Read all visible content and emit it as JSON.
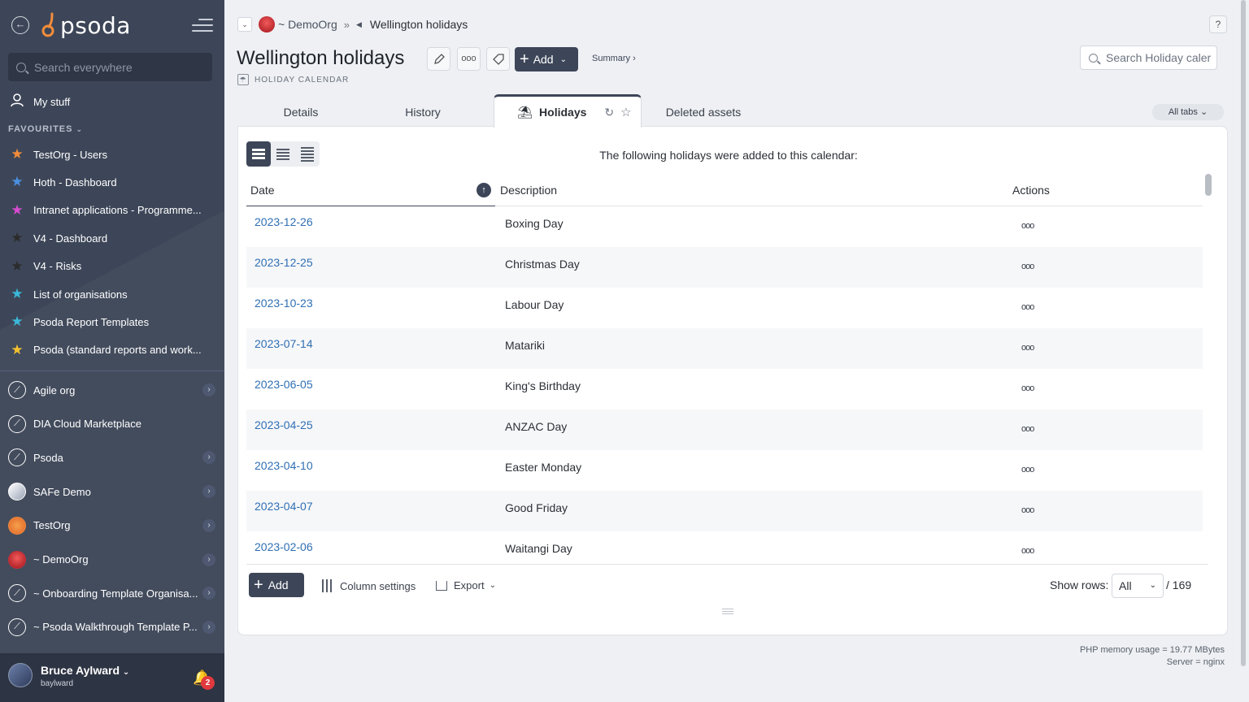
{
  "app": {
    "logo_text": "psoda"
  },
  "sidebar": {
    "search_placeholder": "Search everywhere",
    "my_stuff": "My stuff",
    "favourites_heading": "FAVOURITES",
    "favourites": [
      {
        "label": "TestOrg - Users",
        "color": "#f28c3a"
      },
      {
        "label": "Hoth - Dashboard",
        "color": "#4a90e2"
      },
      {
        "label": "Intranet applications - Programme...",
        "color": "#d84bd0"
      },
      {
        "label": "V4 - Dashboard",
        "color": "#2b2b2b"
      },
      {
        "label": "V4 - Risks",
        "color": "#2b2b2b"
      },
      {
        "label": "List of organisations",
        "color": "#3bb8d8"
      },
      {
        "label": "Psoda Report Templates",
        "color": "#3bb8d8"
      },
      {
        "label": "Psoda (standard reports and work...",
        "color": "#f2c12e"
      }
    ],
    "orgs": [
      {
        "label": "Agile org",
        "expandable": true
      },
      {
        "label": "DIA Cloud Marketplace",
        "expandable": false
      },
      {
        "label": "Psoda",
        "expandable": true
      },
      {
        "label": "SAFe Demo",
        "expandable": true
      },
      {
        "label": "TestOrg",
        "expandable": true
      },
      {
        "label": "~ DemoOrg",
        "expandable": true
      },
      {
        "label": "~ Onboarding Template Organisa...",
        "expandable": true
      },
      {
        "label": "~ Psoda Walkthrough Template P...",
        "expandable": true
      }
    ],
    "user": {
      "name": "Bruce Aylward",
      "login": "baylward",
      "notifications": "2"
    }
  },
  "breadcrumb": {
    "org": "~ DemoOrg",
    "sep": "»",
    "current": "Wellington holidays"
  },
  "header": {
    "title": "Wellington holidays",
    "type_label": "HOLIDAY CALENDAR",
    "add_label": "Add",
    "summary_label": "Summary ›",
    "search_placeholder": "Search Holiday caler",
    "help": "?"
  },
  "tabs": {
    "details": "Details",
    "history": "History",
    "holidays": "Holidays",
    "deleted": "Deleted assets",
    "all_tabs": "All tabs"
  },
  "table": {
    "intro": "The following holidays were added to this calendar:",
    "columns": {
      "date": "Date",
      "description": "Description",
      "actions": "Actions"
    },
    "rows": [
      {
        "date": "2023-12-26",
        "description": "Boxing Day"
      },
      {
        "date": "2023-12-25",
        "description": "Christmas Day"
      },
      {
        "date": "2023-10-23",
        "description": "Labour Day"
      },
      {
        "date": "2023-07-14",
        "description": "Matariki"
      },
      {
        "date": "2023-06-05",
        "description": "King's Birthday"
      },
      {
        "date": "2023-04-25",
        "description": "ANZAC Day"
      },
      {
        "date": "2023-04-10",
        "description": "Easter Monday"
      },
      {
        "date": "2023-04-07",
        "description": "Good Friday"
      },
      {
        "date": "2023-02-06",
        "description": "Waitangi Day"
      }
    ],
    "action_glyph": "ooo"
  },
  "table_footer": {
    "add_label": "Add",
    "column_settings": "Column settings",
    "export": "Export",
    "show_rows_label": "Show rows:",
    "show_rows_value": "All",
    "total": "/ 169"
  },
  "footer": {
    "memory": "PHP memory usage = 19.77 MBytes",
    "server": "Server = nginx"
  }
}
